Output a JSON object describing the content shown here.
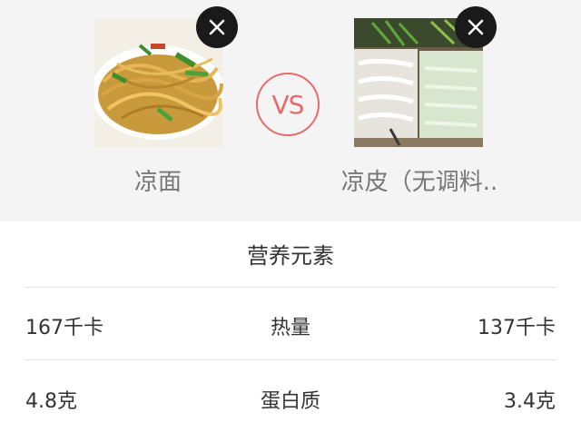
{
  "compare": {
    "left": {
      "name": "凉面",
      "remove_icon": "close-icon"
    },
    "right": {
      "name": "凉皮（无调料..",
      "remove_icon": "close-icon"
    },
    "vs_label": "VS"
  },
  "nutrition": {
    "title": "营养元素",
    "rows": [
      {
        "name": "热量",
        "left": "167千卡",
        "right": "137千卡"
      },
      {
        "name": "蛋白质",
        "left": "4.8克",
        "right": "3.4克"
      }
    ]
  },
  "colors": {
    "header_bg": "#f4f4f4",
    "vs_accent": "#e86a6a",
    "close_btn": "#1a1a1a"
  }
}
